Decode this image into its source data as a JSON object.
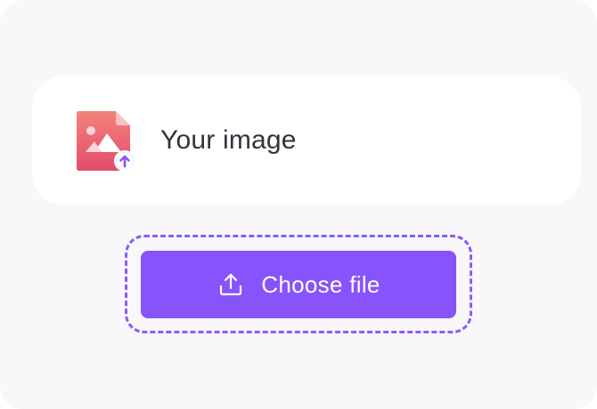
{
  "file_card": {
    "label": "Your image",
    "icon": "image-upload-icon"
  },
  "upload_button": {
    "label": "Choose file",
    "icon": "upload-icon"
  },
  "colors": {
    "background": "#f8f8fa",
    "card": "#ffffff",
    "accent": "#8753fb",
    "accent_dashed": "#8b5cf6",
    "text": "#33333d",
    "icon_gradient_top": "#f3837b",
    "icon_gradient_bottom": "#e34c6a"
  }
}
